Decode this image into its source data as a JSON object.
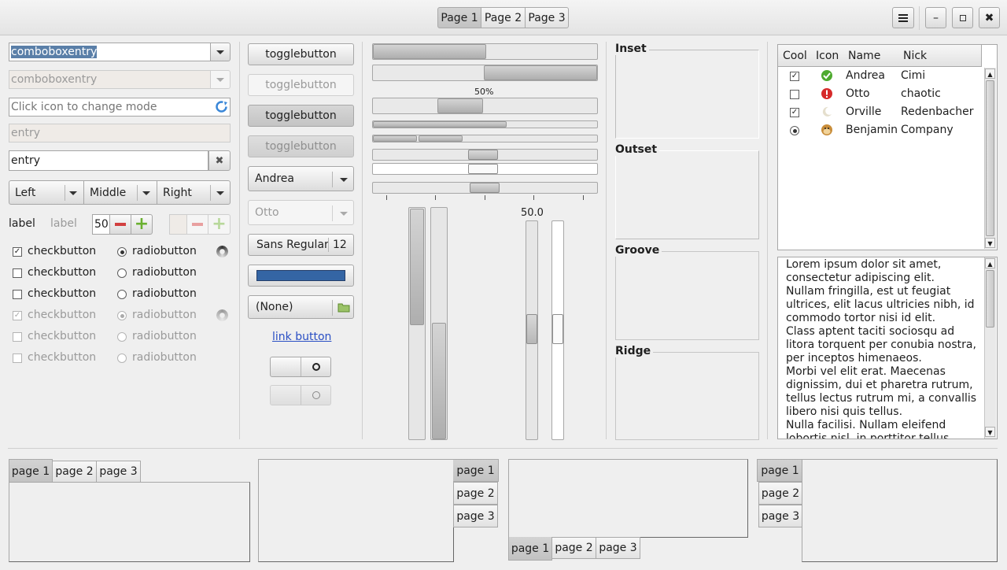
{
  "header": {
    "tabs": [
      {
        "label": "Page 1",
        "active": true
      },
      {
        "label": "Page 2",
        "active": false
      },
      {
        "label": "Page 3",
        "active": false
      }
    ],
    "menu_icon": "hamburger-icon",
    "window_buttons": [
      {
        "name": "minimize",
        "glyph": "–"
      },
      {
        "name": "maximize",
        "glyph": "▫"
      },
      {
        "name": "close",
        "glyph": "✖"
      }
    ]
  },
  "col1": {
    "combo1_value": "comboboxentry",
    "combo2_value": "comboboxentry",
    "icon_entry_placeholder": "Click icon to change mode",
    "entry_disabled": "entry",
    "entry_value": "entry",
    "segments": [
      "Left",
      "Middle",
      "Right"
    ],
    "label1": "label",
    "label2": "label",
    "spin_value": "50",
    "checks": [
      {
        "check": "checkbutton",
        "checked": true,
        "radio": "radiobutton",
        "selected": true,
        "disabled": false,
        "spinner": true
      },
      {
        "check": "checkbutton",
        "checked": false,
        "radio": "radiobutton",
        "selected": false,
        "disabled": false,
        "spinner": false
      },
      {
        "check": "checkbutton",
        "checked": false,
        "radio": "radiobutton",
        "selected": false,
        "disabled": false,
        "spinner": false
      },
      {
        "check": "checkbutton",
        "checked": true,
        "radio": "radiobutton",
        "selected": true,
        "disabled": true,
        "spinner": true
      },
      {
        "check": "checkbutton",
        "checked": false,
        "radio": "radiobutton",
        "selected": false,
        "disabled": true,
        "spinner": false
      },
      {
        "check": "checkbutton",
        "checked": false,
        "radio": "radiobutton",
        "selected": false,
        "disabled": true,
        "spinner": false
      }
    ]
  },
  "col2": {
    "toggle1": "togglebutton",
    "toggle2": "togglebutton",
    "toggle3": "togglebutton",
    "toggle4": "togglebutton",
    "combo_andrea": "Andrea",
    "combo_otto": "Otto",
    "font_name": "Sans Regular",
    "font_size": "12",
    "color_swatch": "#3465a4",
    "file_chooser": "(None)",
    "link": "link button"
  },
  "col3": {
    "progress_label": "50%",
    "scale_value_label": "50.0",
    "progress1": 0.5,
    "progress2": 0.5,
    "progress3": 0.5
  },
  "frames": [
    "Inset",
    "Outset",
    "Groove",
    "Ridge"
  ],
  "tree": {
    "columns": [
      "Cool",
      "Icon",
      "Name",
      "Nick"
    ],
    "rows": [
      {
        "cool": "check",
        "icon": "check-icon",
        "name": "Andrea",
        "nick": "Cimi"
      },
      {
        "cool": "empty",
        "icon": "error-icon",
        "name": "Otto",
        "nick": "chaotic"
      },
      {
        "cool": "check",
        "icon": "moon-icon",
        "name": "Orville",
        "nick": "Redenbacher"
      },
      {
        "cool": "radio",
        "icon": "monkey-icon",
        "name": "Benjamin",
        "nick": "Company"
      }
    ]
  },
  "textview": {
    "lines": [
      "Lorem ipsum dolor sit amet,",
      "consectetur adipiscing elit.",
      "Nullam fringilla, est ut feugiat",
      "ultrices, elit lacus ultricies nibh, id",
      "commodo tortor nisi id elit.",
      "Class aptent taciti sociosqu ad",
      "litora torquent per conubia nostra,",
      "per inceptos himenaeos.",
      "Morbi vel elit erat. Maecenas",
      "dignissim, dui et pharetra rutrum,",
      "tellus lectus rutrum mi, a convallis",
      "libero nisi quis tellus.",
      "Nulla facilisi. Nullam eleifend",
      "lobortis nisl, in porttitor tellus"
    ]
  },
  "notebooks": {
    "tabs": [
      "page 1",
      "page 2",
      "page 3"
    ]
  }
}
